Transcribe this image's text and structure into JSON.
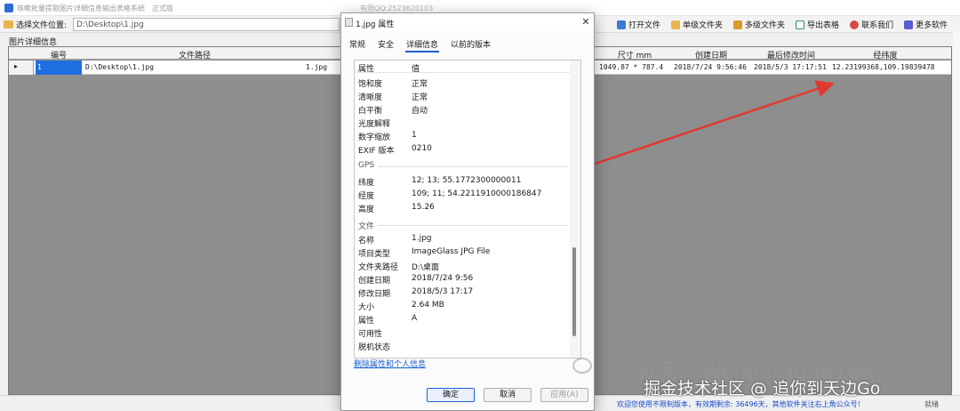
{
  "app": {
    "title": "咳嗽批量提取图片详细信息输出表格系统",
    "title_suffix": "正式版",
    "qq": "有限QQ:2523620103"
  },
  "toolbar": {
    "location_label": "选择文件位置:",
    "path_value": "D:\\Desktop\\1.jpg",
    "buttons": [
      {
        "label": "打开文件",
        "icon": "open-file-icon"
      },
      {
        "label": "单级文件夹",
        "icon": "folder-icon"
      },
      {
        "label": "多级文件夹",
        "icon": "folders-icon"
      },
      {
        "label": "导出表格",
        "icon": "export-icon"
      },
      {
        "label": "联系我们",
        "icon": "contact-icon"
      },
      {
        "label": "更多软件",
        "icon": "grid-icon"
      }
    ]
  },
  "grid": {
    "group_label": "图片详细信息",
    "headers": [
      {
        "label": "编号"
      },
      {
        "label": "文件路径"
      },
      {
        "label": "尺寸 mm"
      },
      {
        "label": "创建日期"
      },
      {
        "label": "最后修改时间"
      },
      {
        "label": "经纬度"
      }
    ],
    "row": {
      "marker": "▸",
      "id": "1",
      "path": "D:\\Desktop\\1.jpg",
      "name": "1.jpg",
      "size_mm": "1049.87 * 787.4",
      "created": "2018/7/24 9:56:46",
      "modified": "2018/5/3 17:17:51",
      "latlng": "12.23199368,109.19839478"
    }
  },
  "dialog": {
    "title": "1.jpg 属性",
    "close": "✕",
    "tabs": [
      {
        "label": "常规",
        "active": false
      },
      {
        "label": "安全",
        "active": false
      },
      {
        "label": "详细信息",
        "active": true
      },
      {
        "label": "以前的版本",
        "active": false
      }
    ],
    "header": {
      "property": "属性",
      "value": "值"
    },
    "rows_top": [
      {
        "k": "饱和度",
        "v": "正常"
      },
      {
        "k": "清晰度",
        "v": "正常"
      },
      {
        "k": "白平衡",
        "v": "自动"
      },
      {
        "k": "光度解释",
        "v": ""
      },
      {
        "k": "数字缩放",
        "v": "1"
      },
      {
        "k": "EXIF 版本",
        "v": "0210"
      }
    ],
    "gps_header": "GPS",
    "rows_gps": [
      {
        "k": "纬度",
        "v": "12; 13; 55.1772300000011"
      },
      {
        "k": "经度",
        "v": "109; 11; 54.2211910000186847"
      },
      {
        "k": "高度",
        "v": "15.26"
      }
    ],
    "file_header": "文件",
    "rows_file": [
      {
        "k": "名称",
        "v": "1.jpg"
      },
      {
        "k": "项目类型",
        "v": "ImageGlass JPG File"
      },
      {
        "k": "文件夹路径",
        "v": "D:\\桌面"
      },
      {
        "k": "创建日期",
        "v": "2018/7/24 9:56"
      },
      {
        "k": "修改日期",
        "v": "2018/5/3 17:17"
      },
      {
        "k": "大小",
        "v": "2.64 MB"
      },
      {
        "k": "属性",
        "v": "A"
      },
      {
        "k": "可用性",
        "v": ""
      },
      {
        "k": "脱机状态",
        "v": ""
      }
    ],
    "remove_link": "删除属性和个人信息",
    "ok": "确定",
    "cancel": "取消",
    "apply": "应用(A)"
  },
  "statusbar": {
    "text": "欢迎您使用不限制版本，有效期剩余: 36496天，其他软件关注右上角公众号！",
    "mode": "就绪"
  },
  "watermark": {
    "line1": "公众号 · Weixin-guga1688",
    "line2": "掘金技术社区 @ 追你到天边Go"
  },
  "colors": {
    "accent": "#1a5fd0",
    "selection": "#1f6fe0",
    "arrow": "#e03a2f",
    "grid_bg": "#8e8e8e"
  }
}
